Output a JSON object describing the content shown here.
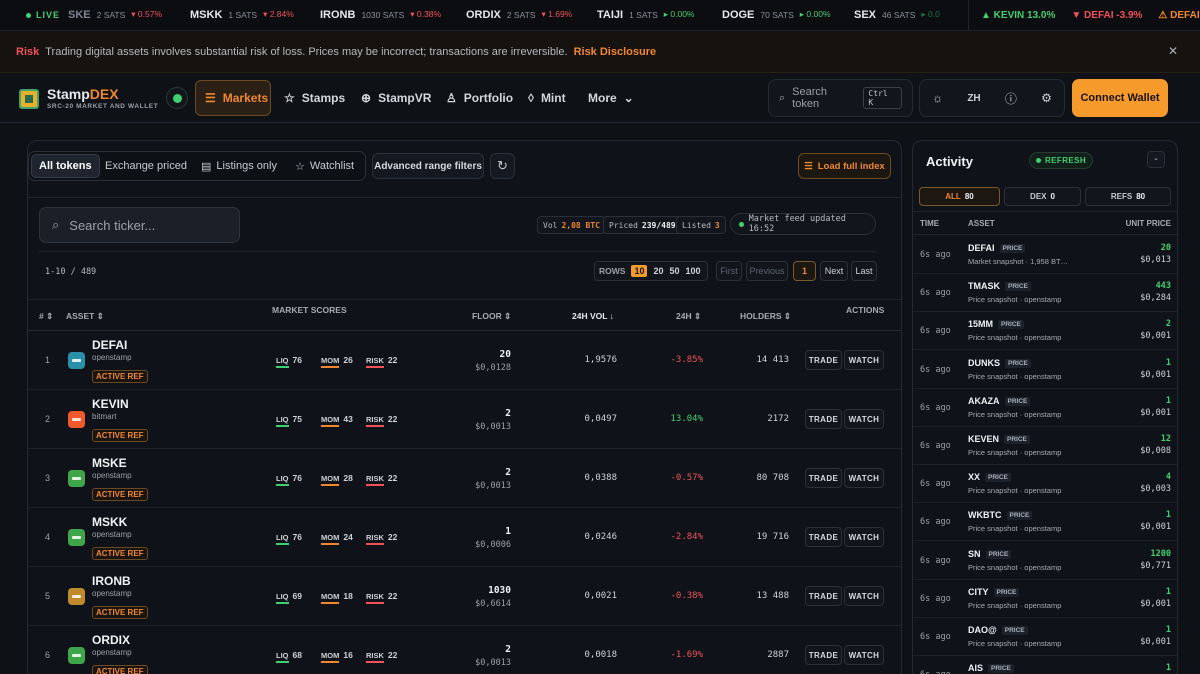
{
  "ticker": {
    "live_label": "LIVE",
    "items": [
      {
        "symbol": "SKE",
        "sats": "2 SATS",
        "change": "▾ 0.57%",
        "dir": "dn"
      },
      {
        "symbol": "MSKK",
        "sats": "1 SATS",
        "change": "▾ 2.84%",
        "dir": "dn"
      },
      {
        "symbol": "IRONB",
        "sats": "1030 SATS",
        "change": "▾ 0.38%",
        "dir": "dn"
      },
      {
        "symbol": "ORDIX",
        "sats": "2 SATS",
        "change": "▾ 1.69%",
        "dir": "dn"
      },
      {
        "symbol": "TAIJI",
        "sats": "1 SATS",
        "change": "▸ 0.00%",
        "dir": "up"
      },
      {
        "symbol": "DOGE",
        "sats": "70 SATS",
        "change": "▸ 0.00%",
        "dir": "up"
      },
      {
        "symbol": "SEX",
        "sats": "46 SATS",
        "change": "▸ 0.0",
        "dir": "up"
      }
    ],
    "right": [
      {
        "text": "▲ KEVIN 13.0%",
        "dir": "up"
      },
      {
        "text": "▼ DEFAI -3.9%",
        "dir": "dn"
      },
      {
        "text": "⚠ DEFAI",
        "dir": "or"
      }
    ]
  },
  "risk": {
    "label": "Risk",
    "message": "Trading digital assets involves substantial risk of loss. Prices may be incorrect; transactions are irreversible.",
    "link": "Risk Disclosure",
    "close": "✕"
  },
  "header": {
    "brand_main": "Stamp",
    "brand_accent": "DEX",
    "brand_sub": "SRC-20 MARKET AND WALLET",
    "nav": [
      {
        "label": "Markets",
        "icon": "☰"
      },
      {
        "label": "Stamps",
        "icon": "☆"
      },
      {
        "label": "StampVR",
        "icon": "⊕"
      },
      {
        "label": "Portfolio",
        "icon": "♙"
      },
      {
        "label": "Mint",
        "icon": "◊"
      },
      {
        "label": "More",
        "icon": "⌄"
      }
    ],
    "search_placeholder": "Search token",
    "search_kbd": "Ctrl K",
    "lang": "ZH",
    "connect": "Connect Wallet"
  },
  "filters": {
    "tabs": [
      "All tokens",
      "Exchange priced",
      "Listings only",
      "Watchlist"
    ],
    "advanced": "Advanced range filters",
    "load_full": "Load full index"
  },
  "market": {
    "search_placeholder": "Search ticker...",
    "vol_label": "Vol",
    "vol_value": "2,08 BTC",
    "priced_label": "Priced",
    "priced_value": "239/489",
    "listed_label": "Listed",
    "listed_value": "3",
    "feed": "Market feed updated 16:52",
    "range": "1-10 / 489",
    "rows_label": "ROWS",
    "rows_options": [
      "10",
      "20",
      "50",
      "100"
    ],
    "pager": {
      "first": "First",
      "previous": "Previous",
      "current": "1",
      "next": "Next",
      "last": "Last"
    }
  },
  "table": {
    "headers": {
      "num": "#",
      "asset": "ASSET",
      "scores": "MARKET SCORES",
      "floor": "FLOOR",
      "vol": "24H VOL",
      "change": "24H",
      "holders": "HOLDERS",
      "actions": "ACTIONS"
    },
    "score_labels": {
      "liq": "LIQ",
      "mom": "MOM",
      "risk": "RISK"
    },
    "ref_label": "ACTIVE REF",
    "trade": "TRADE",
    "watch": "WATCH",
    "rows": [
      {
        "idx": "1",
        "name": "DEFAI",
        "src": "openstamp",
        "color": "#2a8fa8",
        "liq": "76",
        "mom": "26",
        "risk": "22",
        "floor": "20",
        "floor_btc": "$0,0128",
        "vol": "1,9576",
        "change": "-3.85%",
        "dir": "dn",
        "holders": "14 413"
      },
      {
        "idx": "2",
        "name": "KEVIN",
        "src": "bitmart",
        "color": "#f05a2a",
        "liq": "75",
        "mom": "43",
        "risk": "22",
        "floor": "2",
        "floor_btc": "$0,0013",
        "vol": "0,0497",
        "change": "13.04%",
        "dir": "up",
        "holders": "2172"
      },
      {
        "idx": "3",
        "name": "MSKE",
        "src": "openstamp",
        "color": "#3fa54a",
        "liq": "76",
        "mom": "28",
        "risk": "22",
        "floor": "2",
        "floor_btc": "$0,0013",
        "vol": "0,0388",
        "change": "-0.57%",
        "dir": "dn",
        "holders": "80 708"
      },
      {
        "idx": "4",
        "name": "MSKK",
        "src": "openstamp",
        "color": "#3fa54a",
        "liq": "76",
        "mom": "24",
        "risk": "22",
        "floor": "1",
        "floor_btc": "$0,0006",
        "vol": "0,0246",
        "change": "-2.84%",
        "dir": "dn",
        "holders": "19 716"
      },
      {
        "idx": "5",
        "name": "IRONB",
        "src": "openstamp",
        "color": "#c08a2a",
        "liq": "69",
        "mom": "18",
        "risk": "22",
        "floor": "1030",
        "floor_btc": "$0,6614",
        "vol": "0,0021",
        "change": "-0.38%",
        "dir": "dn",
        "holders": "13 488"
      },
      {
        "idx": "6",
        "name": "ORDIX",
        "src": "openstamp",
        "color": "#3fa54a",
        "liq": "68",
        "mom": "16",
        "risk": "22",
        "floor": "2",
        "floor_btc": "$0,0013",
        "vol": "0,0018",
        "change": "-1.69%",
        "dir": "dn",
        "holders": "2887"
      }
    ]
  },
  "activity": {
    "title": "Activity",
    "refresh": "REFRESH",
    "minimize": "-",
    "tabs": [
      {
        "label": "ALL",
        "count": "80"
      },
      {
        "label": "DEX",
        "count": "0"
      },
      {
        "label": "REFS",
        "count": "80"
      }
    ],
    "headers": {
      "time": "TIME",
      "asset": "ASSET",
      "price": "UNIT PRICE"
    },
    "tag": "PRICE",
    "rows": [
      {
        "time": "6s ago",
        "sym": "DEFAI",
        "desc": "Market snapshot · 1,958 BT…",
        "v1": "20",
        "v2": "$0,013"
      },
      {
        "time": "6s ago",
        "sym": "TMASK",
        "desc": "Price snapshot · openstamp",
        "v1": "443",
        "v2": "$0,284"
      },
      {
        "time": "6s ago",
        "sym": "15MM",
        "desc": "Price snapshot · openstamp",
        "v1": "2",
        "v2": "$0,001"
      },
      {
        "time": "6s ago",
        "sym": "DUNKS",
        "desc": "Price snapshot · openstamp",
        "v1": "1",
        "v2": "$0,001"
      },
      {
        "time": "6s ago",
        "sym": "AKAZA",
        "desc": "Price snapshot · openstamp",
        "v1": "1",
        "v2": "$0,001"
      },
      {
        "time": "6s ago",
        "sym": "KEVEN",
        "desc": "Price snapshot · openstamp",
        "v1": "12",
        "v2": "$0,008"
      },
      {
        "time": "6s ago",
        "sym": "XX",
        "desc": "Price snapshot · openstamp",
        "v1": "4",
        "v2": "$0,003"
      },
      {
        "time": "6s ago",
        "sym": "WKBTC",
        "desc": "Price snapshot · openstamp",
        "v1": "1",
        "v2": "$0,001"
      },
      {
        "time": "6s ago",
        "sym": "SN",
        "desc": "Price snapshot · openstamp",
        "v1": "1200",
        "v2": "$0,771"
      },
      {
        "time": "6s ago",
        "sym": "CITY",
        "desc": "Price snapshot · openstamp",
        "v1": "1",
        "v2": "$0,001"
      },
      {
        "time": "6s ago",
        "sym": "DAO@",
        "desc": "Price snapshot · openstamp",
        "v1": "1",
        "v2": "$0,001"
      },
      {
        "time": "6s ago",
        "sym": "AIS",
        "desc": "Price snapshot · openstamp",
        "v1": "1",
        "v2": ""
      }
    ]
  }
}
